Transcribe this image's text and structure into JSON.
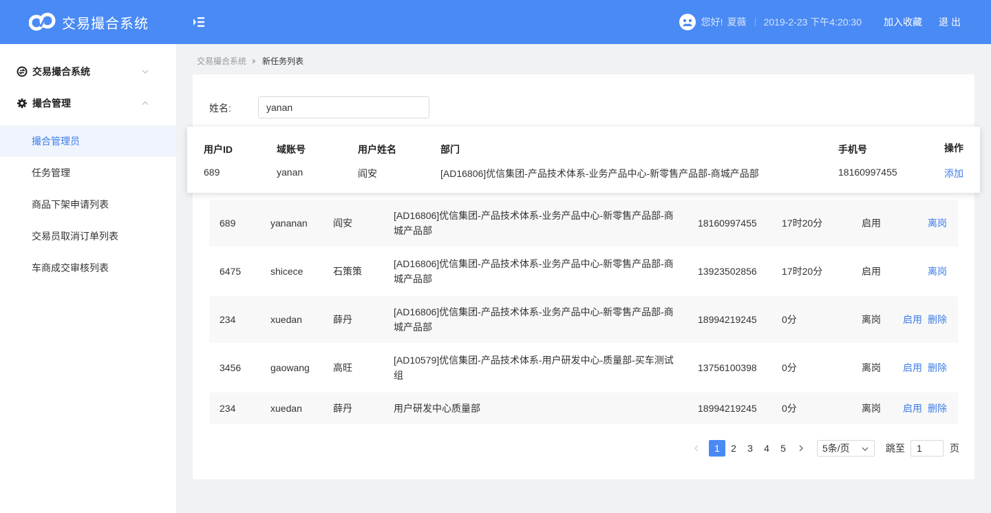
{
  "header": {
    "app_title": "交易撮合系统",
    "greeting": "您好!",
    "user_name": "夏薇",
    "datetime": "2019-2-23 下午4:20:30",
    "bookmark_label": "加入收藏",
    "logout_label": "退出",
    "brand_color": "#4a8af4"
  },
  "sidebar": {
    "groups": [
      {
        "label": "交易撮合系统",
        "icon": "exchange-icon",
        "expanded": false
      },
      {
        "label": "撮合管理",
        "icon": "gear-icon",
        "expanded": true
      }
    ],
    "items": [
      {
        "label": "撮合管理员",
        "active": true
      },
      {
        "label": "任务管理",
        "active": false
      },
      {
        "label": "商品下架申请列表",
        "active": false
      },
      {
        "label": "交易员取消订单列表",
        "active": false
      },
      {
        "label": "车商成交审核列表",
        "active": false
      }
    ]
  },
  "breadcrumb": [
    "交易撮合系统",
    "新任务列表"
  ],
  "search": {
    "label": "姓名:",
    "value": "yanan"
  },
  "dropdown": {
    "headers": [
      "用户ID",
      "域账号",
      "用户姓名",
      "部门",
      "手机号",
      "操作"
    ],
    "row": {
      "id": "689",
      "account": "yanan",
      "name": "阎安",
      "dept": "[AD16806]优信集团-产品技术体系-业务产品中心-新零售产品部-商城产品部",
      "phone": "18160997455",
      "action": "添加"
    }
  },
  "table": {
    "rows": [
      {
        "id": "689",
        "account": "yananan",
        "name": "阎安",
        "dept": "[AD16806]优信集团-产品技术体系-业务产品中心-新零售产品部-商城产品部",
        "phone": "18160997455",
        "duration": "17时20分",
        "status": "启用",
        "actions": [
          "离岗"
        ]
      },
      {
        "id": "6475",
        "account": "shicece",
        "name": "石策策",
        "dept": "[AD16806]优信集团-产品技术体系-业务产品中心-新零售产品部-商城产品部",
        "phone": "13923502856",
        "duration": "17时20分",
        "status": "启用",
        "actions": [
          "离岗"
        ]
      },
      {
        "id": "234",
        "account": "xuedan",
        "name": "薛丹",
        "dept": "[AD16806]优信集团-产品技术体系-业务产品中心-新零售产品部-商城产品部",
        "phone": "18994219245",
        "duration": "0分",
        "status": "离岗",
        "actions": [
          "启用",
          "删除"
        ]
      },
      {
        "id": "3456",
        "account": "gaowang",
        "name": "高旺",
        "dept": "[AD10579]优信集团-产品技术体系-用户研发中心-质量部-买车测试组",
        "phone": "13756100398",
        "duration": "0分",
        "status": "离岗",
        "actions": [
          "启用",
          "删除"
        ]
      },
      {
        "id": "234",
        "account": "xuedan",
        "name": "薛丹",
        "dept": "用户研发中心质量部",
        "phone": "18994219245",
        "duration": "0分",
        "status": "离岗",
        "actions": [
          "启用",
          "删除"
        ]
      }
    ]
  },
  "pagination": {
    "pages": [
      "1",
      "2",
      "3",
      "4",
      "5"
    ],
    "current": "1",
    "page_size": "5条/页",
    "jump_label": "跳至",
    "jump_value": "1",
    "page_suffix": "页"
  }
}
